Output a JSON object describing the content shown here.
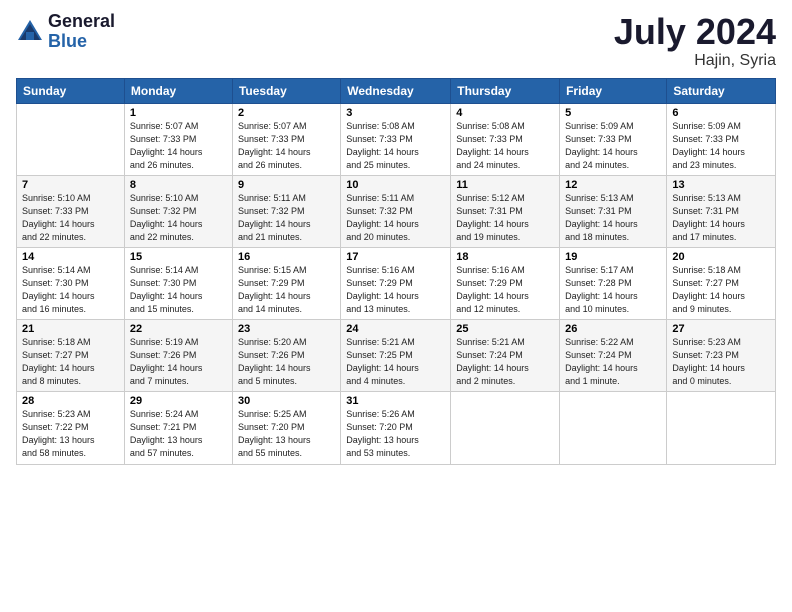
{
  "logo": {
    "general": "General",
    "blue": "Blue"
  },
  "title": "July 2024",
  "subtitle": "Hajin, Syria",
  "weekdays": [
    "Sunday",
    "Monday",
    "Tuesday",
    "Wednesday",
    "Thursday",
    "Friday",
    "Saturday"
  ],
  "weeks": [
    [
      {
        "day": "",
        "sunrise": "",
        "sunset": "",
        "daylight": ""
      },
      {
        "day": "1",
        "sunrise": "Sunrise: 5:07 AM",
        "sunset": "Sunset: 7:33 PM",
        "daylight": "Daylight: 14 hours and 26 minutes."
      },
      {
        "day": "2",
        "sunrise": "Sunrise: 5:07 AM",
        "sunset": "Sunset: 7:33 PM",
        "daylight": "Daylight: 14 hours and 26 minutes."
      },
      {
        "day": "3",
        "sunrise": "Sunrise: 5:08 AM",
        "sunset": "Sunset: 7:33 PM",
        "daylight": "Daylight: 14 hours and 25 minutes."
      },
      {
        "day": "4",
        "sunrise": "Sunrise: 5:08 AM",
        "sunset": "Sunset: 7:33 PM",
        "daylight": "Daylight: 14 hours and 24 minutes."
      },
      {
        "day": "5",
        "sunrise": "Sunrise: 5:09 AM",
        "sunset": "Sunset: 7:33 PM",
        "daylight": "Daylight: 14 hours and 24 minutes."
      },
      {
        "day": "6",
        "sunrise": "Sunrise: 5:09 AM",
        "sunset": "Sunset: 7:33 PM",
        "daylight": "Daylight: 14 hours and 23 minutes."
      }
    ],
    [
      {
        "day": "7",
        "sunrise": "Sunrise: 5:10 AM",
        "sunset": "Sunset: 7:33 PM",
        "daylight": "Daylight: 14 hours and 22 minutes."
      },
      {
        "day": "8",
        "sunrise": "Sunrise: 5:10 AM",
        "sunset": "Sunset: 7:32 PM",
        "daylight": "Daylight: 14 hours and 22 minutes."
      },
      {
        "day": "9",
        "sunrise": "Sunrise: 5:11 AM",
        "sunset": "Sunset: 7:32 PM",
        "daylight": "Daylight: 14 hours and 21 minutes."
      },
      {
        "day": "10",
        "sunrise": "Sunrise: 5:11 AM",
        "sunset": "Sunset: 7:32 PM",
        "daylight": "Daylight: 14 hours and 20 minutes."
      },
      {
        "day": "11",
        "sunrise": "Sunrise: 5:12 AM",
        "sunset": "Sunset: 7:31 PM",
        "daylight": "Daylight: 14 hours and 19 minutes."
      },
      {
        "day": "12",
        "sunrise": "Sunrise: 5:13 AM",
        "sunset": "Sunset: 7:31 PM",
        "daylight": "Daylight: 14 hours and 18 minutes."
      },
      {
        "day": "13",
        "sunrise": "Sunrise: 5:13 AM",
        "sunset": "Sunset: 7:31 PM",
        "daylight": "Daylight: 14 hours and 17 minutes."
      }
    ],
    [
      {
        "day": "14",
        "sunrise": "Sunrise: 5:14 AM",
        "sunset": "Sunset: 7:30 PM",
        "daylight": "Daylight: 14 hours and 16 minutes."
      },
      {
        "day": "15",
        "sunrise": "Sunrise: 5:14 AM",
        "sunset": "Sunset: 7:30 PM",
        "daylight": "Daylight: 14 hours and 15 minutes."
      },
      {
        "day": "16",
        "sunrise": "Sunrise: 5:15 AM",
        "sunset": "Sunset: 7:29 PM",
        "daylight": "Daylight: 14 hours and 14 minutes."
      },
      {
        "day": "17",
        "sunrise": "Sunrise: 5:16 AM",
        "sunset": "Sunset: 7:29 PM",
        "daylight": "Daylight: 14 hours and 13 minutes."
      },
      {
        "day": "18",
        "sunrise": "Sunrise: 5:16 AM",
        "sunset": "Sunset: 7:29 PM",
        "daylight": "Daylight: 14 hours and 12 minutes."
      },
      {
        "day": "19",
        "sunrise": "Sunrise: 5:17 AM",
        "sunset": "Sunset: 7:28 PM",
        "daylight": "Daylight: 14 hours and 10 minutes."
      },
      {
        "day": "20",
        "sunrise": "Sunrise: 5:18 AM",
        "sunset": "Sunset: 7:27 PM",
        "daylight": "Daylight: 14 hours and 9 minutes."
      }
    ],
    [
      {
        "day": "21",
        "sunrise": "Sunrise: 5:18 AM",
        "sunset": "Sunset: 7:27 PM",
        "daylight": "Daylight: 14 hours and 8 minutes."
      },
      {
        "day": "22",
        "sunrise": "Sunrise: 5:19 AM",
        "sunset": "Sunset: 7:26 PM",
        "daylight": "Daylight: 14 hours and 7 minutes."
      },
      {
        "day": "23",
        "sunrise": "Sunrise: 5:20 AM",
        "sunset": "Sunset: 7:26 PM",
        "daylight": "Daylight: 14 hours and 5 minutes."
      },
      {
        "day": "24",
        "sunrise": "Sunrise: 5:21 AM",
        "sunset": "Sunset: 7:25 PM",
        "daylight": "Daylight: 14 hours and 4 minutes."
      },
      {
        "day": "25",
        "sunrise": "Sunrise: 5:21 AM",
        "sunset": "Sunset: 7:24 PM",
        "daylight": "Daylight: 14 hours and 2 minutes."
      },
      {
        "day": "26",
        "sunrise": "Sunrise: 5:22 AM",
        "sunset": "Sunset: 7:24 PM",
        "daylight": "Daylight: 14 hours and 1 minute."
      },
      {
        "day": "27",
        "sunrise": "Sunrise: 5:23 AM",
        "sunset": "Sunset: 7:23 PM",
        "daylight": "Daylight: 14 hours and 0 minutes."
      }
    ],
    [
      {
        "day": "28",
        "sunrise": "Sunrise: 5:23 AM",
        "sunset": "Sunset: 7:22 PM",
        "daylight": "Daylight: 13 hours and 58 minutes."
      },
      {
        "day": "29",
        "sunrise": "Sunrise: 5:24 AM",
        "sunset": "Sunset: 7:21 PM",
        "daylight": "Daylight: 13 hours and 57 minutes."
      },
      {
        "day": "30",
        "sunrise": "Sunrise: 5:25 AM",
        "sunset": "Sunset: 7:20 PM",
        "daylight": "Daylight: 13 hours and 55 minutes."
      },
      {
        "day": "31",
        "sunrise": "Sunrise: 5:26 AM",
        "sunset": "Sunset: 7:20 PM",
        "daylight": "Daylight: 13 hours and 53 minutes."
      },
      {
        "day": "",
        "sunrise": "",
        "sunset": "",
        "daylight": ""
      },
      {
        "day": "",
        "sunrise": "",
        "sunset": "",
        "daylight": ""
      },
      {
        "day": "",
        "sunrise": "",
        "sunset": "",
        "daylight": ""
      }
    ]
  ]
}
